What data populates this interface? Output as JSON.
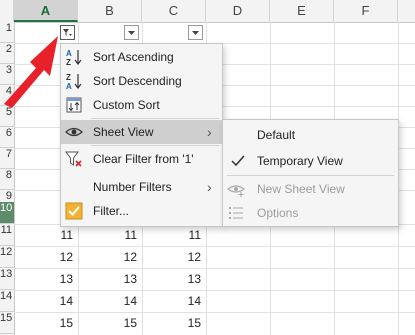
{
  "column_headers": [
    "A",
    "B",
    "C",
    "D",
    "E",
    "F"
  ],
  "row_headers": [
    "1",
    "2",
    "3",
    "4",
    "5",
    "6",
    "7",
    "8",
    "9",
    "10",
    "11",
    "12",
    "13",
    "14",
    "15"
  ],
  "rows": [
    [
      "11",
      "11",
      "11"
    ],
    [
      "12",
      "12",
      "12"
    ],
    [
      "13",
      "13",
      "13"
    ],
    [
      "14",
      "14",
      "14"
    ],
    [
      "15",
      "15",
      "15"
    ]
  ],
  "filter_menu": {
    "sort_ascending": "Sort Ascending",
    "sort_descending": "Sort Descending",
    "custom_sort": "Custom Sort",
    "sheet_view": "Sheet View",
    "clear_filter": "Clear Filter from '1'",
    "number_filters": "Number Filters",
    "filter": "Filter..."
  },
  "sheet_view_menu": {
    "default": "Default",
    "temporary_view": "Temporary View",
    "new_sheet_view": "New Sheet View",
    "options": "Options",
    "checked": "Temporary View"
  },
  "colors": {
    "annotation_arrow": "#e8202a",
    "selected_header_green": "#217346",
    "menu_highlight": "#cfcfcf",
    "filter_checkbox": "#f2b233"
  }
}
